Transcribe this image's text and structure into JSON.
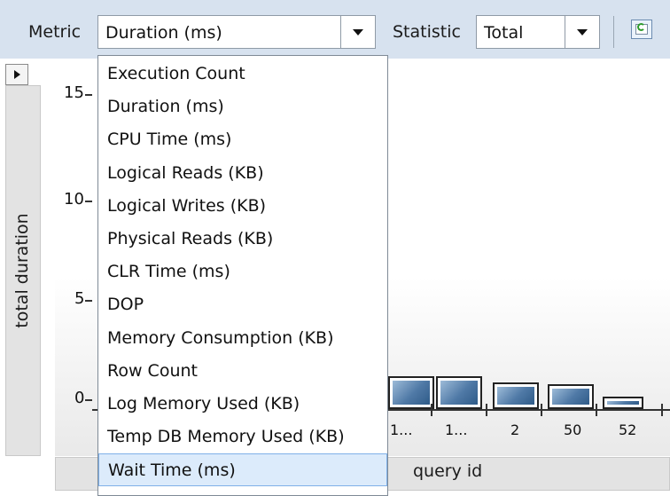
{
  "toolbar": {
    "metric_label": "Metric",
    "metric_value": "Duration (ms)",
    "statistic_label": "Statistic",
    "statistic_value": "Total",
    "refresh_icon": "refresh-icon"
  },
  "chart": {
    "ylabel": "total duration",
    "xlabel": "query id",
    "yticks": [
      "15",
      "10",
      "5",
      "0"
    ],
    "xticks": [
      "1...",
      "1...",
      "2",
      "50",
      "52"
    ]
  },
  "chart_data": {
    "type": "bar",
    "title": "",
    "xlabel": "query id",
    "ylabel": "total duration",
    "categories": [
      "1...",
      "1...",
      "2",
      "50",
      "52"
    ],
    "values": [
      1.6,
      1.6,
      1.3,
      1.2,
      0.6
    ],
    "ylim": [
      0,
      16
    ],
    "grid": false
  },
  "dropdown": {
    "items": [
      "Execution Count",
      "Duration (ms)",
      "CPU Time (ms)",
      "Logical Reads (KB)",
      "Logical Writes (KB)",
      "Physical Reads (KB)",
      "CLR Time (ms)",
      "DOP",
      "Memory Consumption (KB)",
      "Row Count",
      "Log Memory Used (KB)",
      "Temp DB Memory Used (KB)",
      "Wait Time (ms)"
    ],
    "highlighted": "Wait Time (ms)"
  },
  "colors": {
    "toolbar_bg": "#d7e2ef",
    "bar_fill": "#4f79a6",
    "highlight": "#dcebfb"
  }
}
